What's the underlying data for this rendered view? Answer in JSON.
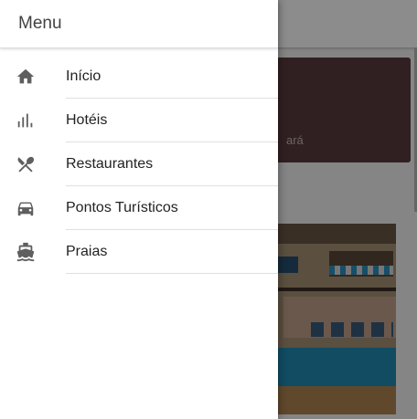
{
  "drawer": {
    "title": "Menu",
    "items": [
      {
        "label": "Início",
        "icon": "home-icon"
      },
      {
        "label": "Hotéis",
        "icon": "bar-chart-icon"
      },
      {
        "label": "Restaurantes",
        "icon": "utensils-icon"
      },
      {
        "label": "Pontos Turísticos",
        "icon": "car-icon"
      },
      {
        "label": "Praias",
        "icon": "boat-icon"
      }
    ]
  },
  "background": {
    "card_text_fragment": "ará"
  },
  "colors": {
    "drawer_background": "#ffffff",
    "icon_color": "#5f5f5f",
    "card_color": "#5a3b3e",
    "divider": "#e0e0e0"
  }
}
